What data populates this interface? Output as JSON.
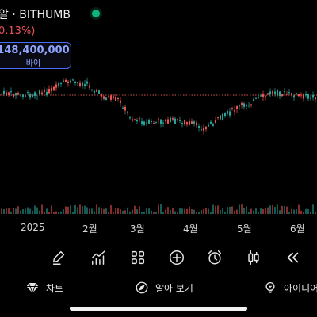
{
  "header": {
    "title": "알 · BITHUMB",
    "change": "0.13%)",
    "live_color": "#0fb37a"
  },
  "buy_box": {
    "price": "148,400,000",
    "label": "바이"
  },
  "chart": {
    "x_labels": [
      "2025",
      "2월",
      "3월",
      "4월",
      "5월",
      "6월"
    ],
    "up_color": "#26a69a",
    "down_color": "#ef5350",
    "price_line_color": "#d9534f"
  },
  "toolbar": {
    "icons": [
      "pen-icon",
      "indicator-icon",
      "grid-icon",
      "plus-circle-icon",
      "alarm-icon",
      "candle-icon",
      "rewind-icon"
    ]
  },
  "bottom_nav": {
    "chart_label": "차트",
    "explore_label": "알아 보기",
    "ideas_label": "아이디어"
  }
}
